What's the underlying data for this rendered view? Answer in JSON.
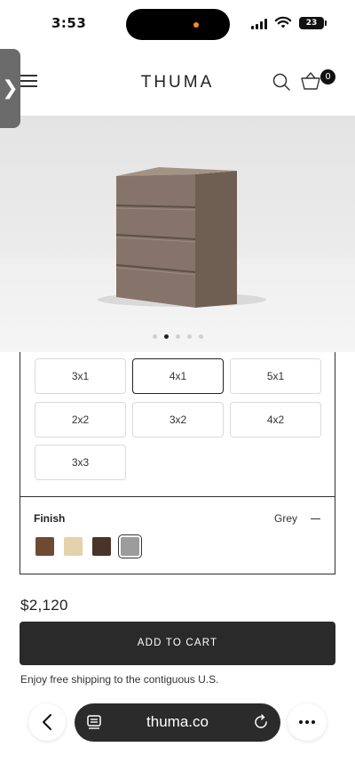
{
  "status_bar": {
    "time": "3:53",
    "battery": "23"
  },
  "header": {
    "logo": "THUMA",
    "cart_count": "0",
    "icons": [
      "menu-icon",
      "search-icon",
      "cart-icon"
    ]
  },
  "hero": {
    "carousel_total": 5,
    "carousel_active_index": 1
  },
  "configurator": {
    "size_options": [
      "3x1",
      "4x1",
      "5x1",
      "2x2",
      "3x2",
      "4x2",
      "3x3"
    ],
    "selected_size": "4x1",
    "finish": {
      "label": "Finish",
      "value": "Grey",
      "toggle": "collapse",
      "swatches": [
        {
          "name": "walnut",
          "color": "#6e4a33"
        },
        {
          "name": "natural",
          "color": "#e3d2ac"
        },
        {
          "name": "espresso",
          "color": "#4a3428"
        },
        {
          "name": "grey",
          "color": "#9c9c9c",
          "selected": true
        }
      ]
    }
  },
  "purchase": {
    "price": "$2,120",
    "add_to_cart_label": "ADD TO CART",
    "shipping_note": "Enjoy free shipping to the contiguous U.S."
  },
  "browser": {
    "url": "thuma.co"
  },
  "colors": {
    "accent": "#2a2a2a",
    "hero_bg": "#e8e8e8",
    "dresser": "#7d6b5f",
    "status_dot": "#ff8a1f"
  }
}
